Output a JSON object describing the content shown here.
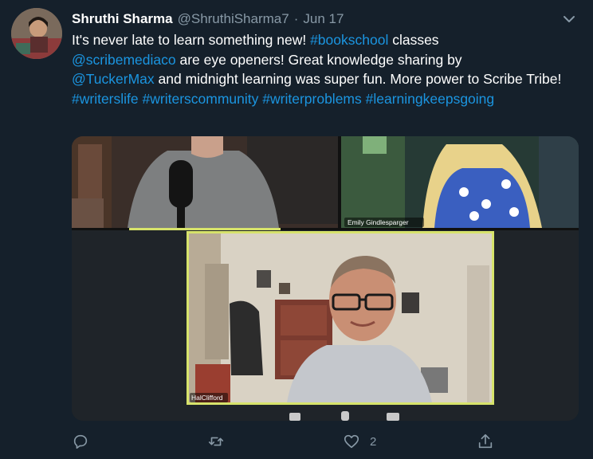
{
  "tweet": {
    "author_name": "Shruthi Sharma",
    "author_handle": "@ShruthiSharma7",
    "separator": "·",
    "date": "Jun 17",
    "text_parts": {
      "p1": "It's never late to learn something new! ",
      "bookschool": "#bookschool",
      "p2": " classes",
      "mention_scribe": "@scribemediaco",
      "p3": " are eye openers! Great knowledge sharing by",
      "mention_tucker": "@TuckerMax",
      "p4": " and midnight learning was super fun. More power to Scribe Tribe!",
      "hashtag_1": "#writerslife",
      "hashtag_2": "#writerscommunity",
      "hashtag_3": "#writerproblems",
      "hashtag_4": "#learningkeepsgoing"
    }
  },
  "media": {
    "participant_top_right": "Emily Gindlesparger",
    "participant_main": "HalClifford"
  },
  "actions": {
    "reply_icon": "reply-icon",
    "retweet_icon": "retweet-icon",
    "like_icon": "heart-icon",
    "like_count": "2",
    "share_icon": "share-icon"
  },
  "colors": {
    "background": "#15202b",
    "link": "#1b95e0",
    "muted": "#8899a6",
    "speaker_highlight": "#d7e36b"
  }
}
